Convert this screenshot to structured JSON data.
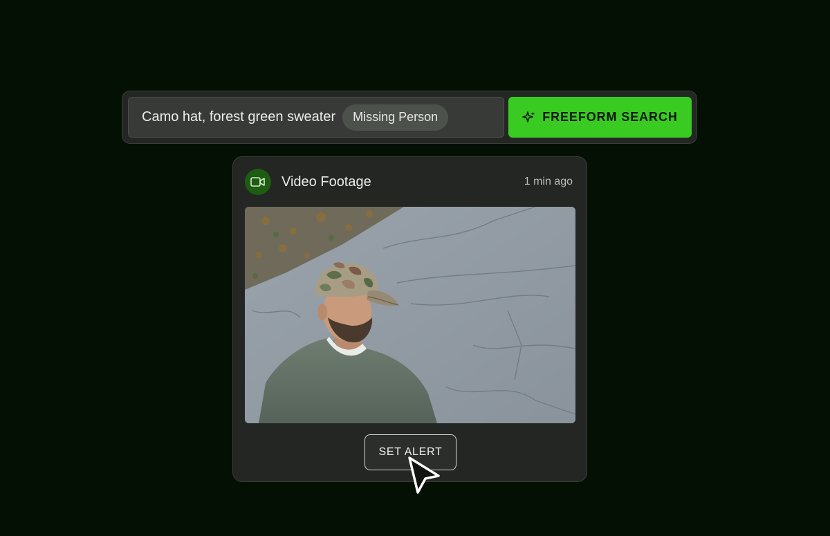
{
  "search": {
    "query": "Camo hat, forest green sweater",
    "tag": "Missing Person",
    "button_label": "FREEFORM SEARCH",
    "button_icon": "sparkle-icon"
  },
  "card": {
    "icon": "video-camera-icon",
    "title": "Video Footage",
    "time": "1 min ago",
    "image": "Surveillance still of a man in a camo cap and green sweater on a pavement",
    "alert_label": "SET ALERT"
  },
  "colors": {
    "background": "#031003",
    "accent": "#3acb22",
    "panel": "#232622",
    "badge": "#1d5d12"
  }
}
